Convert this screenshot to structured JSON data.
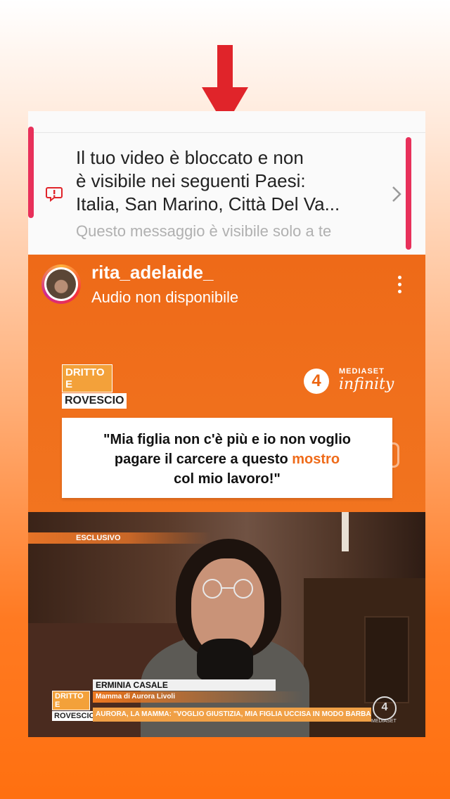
{
  "notification": {
    "lines": [
      "Il tuo video è bloccato e non",
      "è visibile nei seguenti Paesi:",
      "Italia, San Marino, Città Del Va..."
    ],
    "note": "Questo messaggio è visibile solo a te",
    "icons": {
      "alert": "alert-message-icon",
      "chevron": "chevron-right-icon",
      "arrow": "down-arrow-icon"
    }
  },
  "post": {
    "username": "rita_adelaide_",
    "audio": "Audio non disponibile",
    "menu_icon": "more-vertical-icon"
  },
  "video": {
    "show_logo_top": "DRITTO E",
    "show_logo_bottom": "ROVESCIO",
    "channel_number": "4",
    "channel_brand_small": "MEDIASET",
    "channel_brand": "infinity",
    "quote_part1": "\"Mia figlia non c'è più e io non voglio",
    "quote_part2": "pagare il carcere a questo ",
    "quote_highlight": "mostro",
    "quote_part3": "col mio lavoro!\"",
    "exclusive": "ESCLUSIVO",
    "person_name": "ERMINIA CASALE",
    "person_role": "Mamma di Aurora Livoli",
    "headline": "AURORA, LA MAMMA: \"VOGLIO GIUSTIZIA, MIA FIGLIA UCCISA IN MODO BARBARO\"",
    "corner_number": "4",
    "corner_brand": "MEDIASET"
  },
  "colors": {
    "accent_orange": "#ef6b1a",
    "arrow_red": "#e0242a",
    "bracket_pink": "#e8305a",
    "alert_red": "#e0242a"
  }
}
